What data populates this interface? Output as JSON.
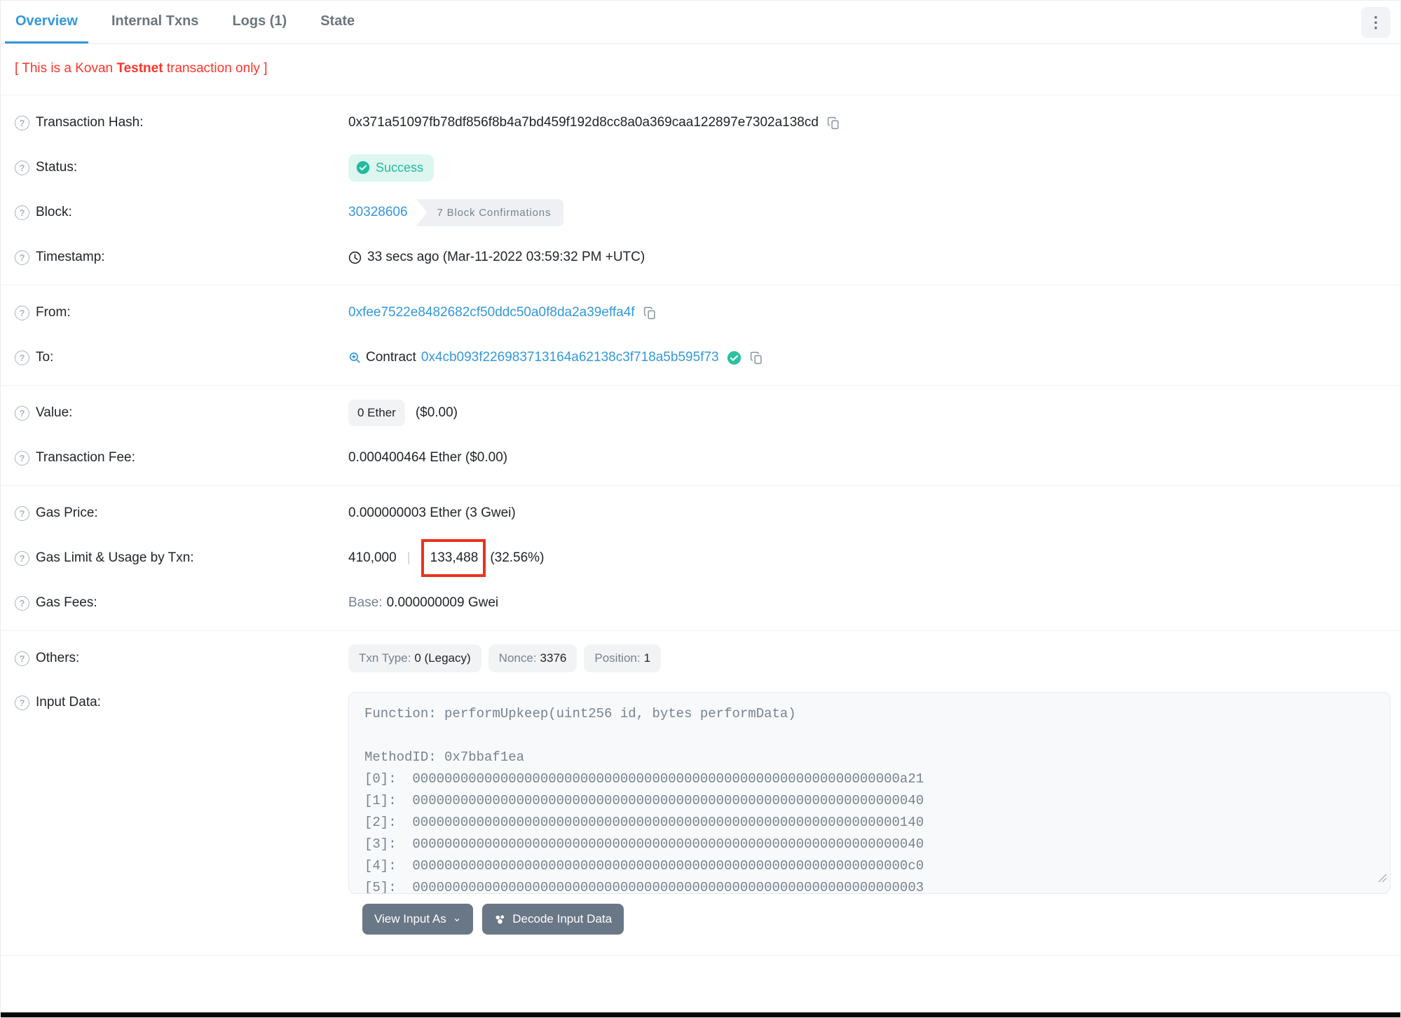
{
  "tabs": [
    {
      "label": "Overview",
      "active": true
    },
    {
      "label": "Internal Txns",
      "active": false
    },
    {
      "label": "Logs (1)",
      "active": false
    },
    {
      "label": "State",
      "active": false
    }
  ],
  "notice": {
    "prefix": "[ This is a Kovan ",
    "bold": "Testnet",
    "suffix": " transaction only ]"
  },
  "rows": {
    "transaction_hash": {
      "label": "Transaction Hash:",
      "value": "0x371a51097fb78df856f8b4a7bd459f192d8cc8a0a369caa122897e7302a138cd"
    },
    "status": {
      "label": "Status:",
      "value": "Success"
    },
    "block": {
      "label": "Block:",
      "value": "30328606",
      "confirmations": "7 Block Confirmations"
    },
    "timestamp": {
      "label": "Timestamp:",
      "value": "33 secs ago (Mar-11-2022 03:59:32 PM +UTC)"
    },
    "from": {
      "label": "From:",
      "value": "0xfee7522e8482682cf50ddc50a0f8da2a39effa4f"
    },
    "to": {
      "label": "To:",
      "kind": "Contract",
      "value": "0x4cb093f226983713164a62138c3f718a5b595f73"
    },
    "value": {
      "label": "Value:",
      "badge": "0 Ether",
      "usd": "($0.00)"
    },
    "transaction_fee": {
      "label": "Transaction Fee:",
      "value": "0.000400464 Ether ($0.00)"
    },
    "gas_price": {
      "label": "Gas Price:",
      "value": "0.000000003 Ether (3 Gwei)"
    },
    "gas_limit_usage": {
      "label": "Gas Limit & Usage by Txn:",
      "limit": "410,000",
      "separator": "|",
      "used": "133,488",
      "percent": "(32.56%)"
    },
    "gas_fees": {
      "label": "Gas Fees:",
      "base_label": "Base:",
      "base_value": "0.000000009 Gwei"
    },
    "others": {
      "label": "Others:",
      "badges": [
        {
          "name": "Txn Type:",
          "value": "0 (Legacy)"
        },
        {
          "name": "Nonce:",
          "value": "3376"
        },
        {
          "name": "Position:",
          "value": "1"
        }
      ]
    },
    "input_data": {
      "label": "Input Data:",
      "function_line": "Function: performUpkeep(uint256 id, bytes performData)",
      "method_id_line": "MethodID: 0x7bbaf1ea",
      "params": [
        {
          "index": "[0]:",
          "value": "0000000000000000000000000000000000000000000000000000000000000a21"
        },
        {
          "index": "[1]:",
          "value": "0000000000000000000000000000000000000000000000000000000000000040"
        },
        {
          "index": "[2]:",
          "value": "0000000000000000000000000000000000000000000000000000000000000140"
        },
        {
          "index": "[3]:",
          "value": "0000000000000000000000000000000000000000000000000000000000000040"
        },
        {
          "index": "[4]:",
          "value": "00000000000000000000000000000000000000000000000000000000000000c0"
        },
        {
          "index": "[5]:",
          "value": "0000000000000000000000000000000000000000000000000000000000000003"
        }
      ]
    }
  },
  "buttons": {
    "view_input_as": "View Input As",
    "decode_input_data": "Decode Input Data"
  },
  "icons": {
    "question": "?",
    "more": "⋮",
    "chevron_down": "⌄"
  },
  "colors": {
    "link_blue": "#3498db",
    "active_tab_blue": "#3398da",
    "success_teal": "#23ba9e",
    "success_bg": "#ddf6ef",
    "notice_red": "#fe342a",
    "annotation_red": "#e8331f",
    "badge_gray_bg": "#f2f3f5",
    "muted_gray": "#77838f",
    "button_slate": "#697786"
  }
}
